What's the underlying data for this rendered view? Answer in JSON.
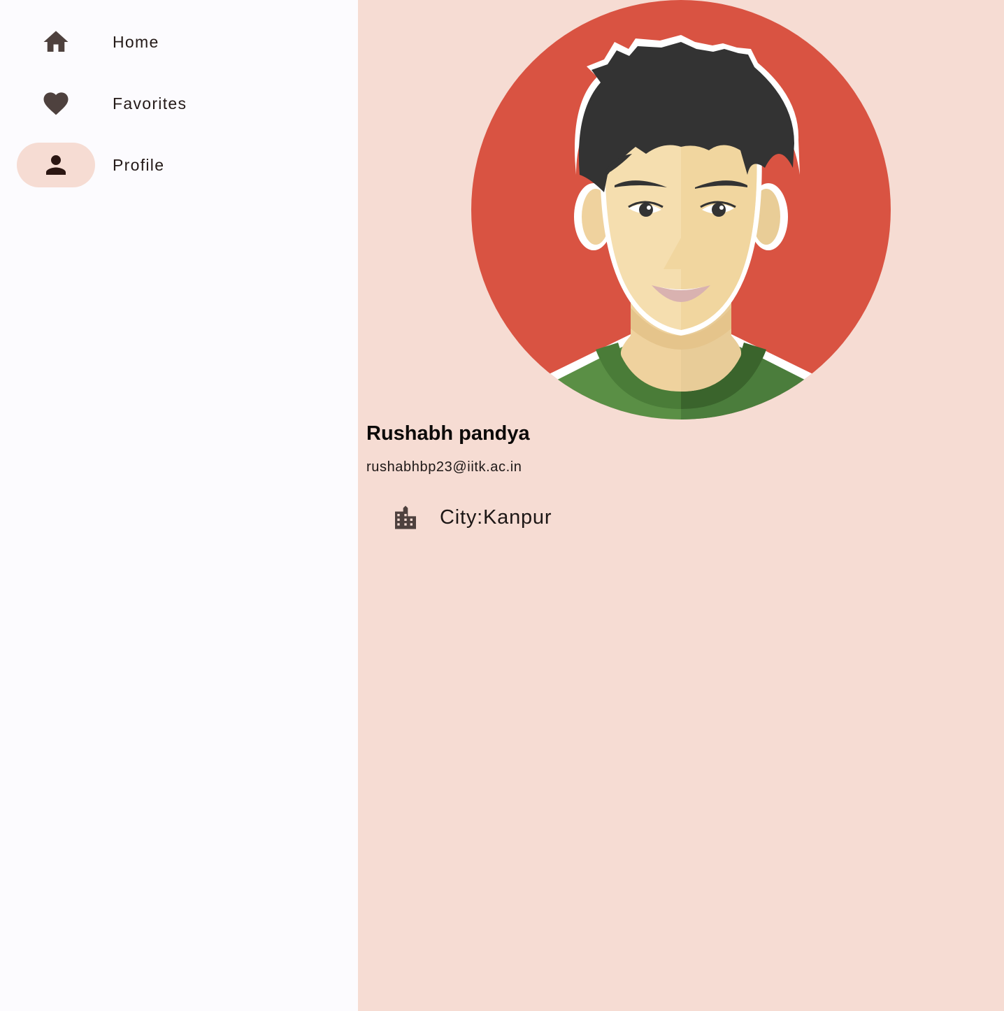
{
  "nav": {
    "items": [
      {
        "label": "Home",
        "icon": "home-icon",
        "selected": false
      },
      {
        "label": "Favorites",
        "icon": "heart-icon",
        "selected": false
      },
      {
        "label": "Profile",
        "icon": "person-icon",
        "selected": true
      }
    ]
  },
  "profile": {
    "name": "Rushabh pandya",
    "email": "rushabhbp23@iitk.ac.in",
    "city": "City:Kanpur",
    "city_icon": "city-building-icon",
    "avatar": "avatar-illustration"
  },
  "colors": {
    "nav_background": "#fcfbfe",
    "content_background": "#f6dcd3",
    "selected_pill": "#f6dcd3",
    "icon_color": "#4e413e",
    "avatar_background": "#d95342"
  }
}
